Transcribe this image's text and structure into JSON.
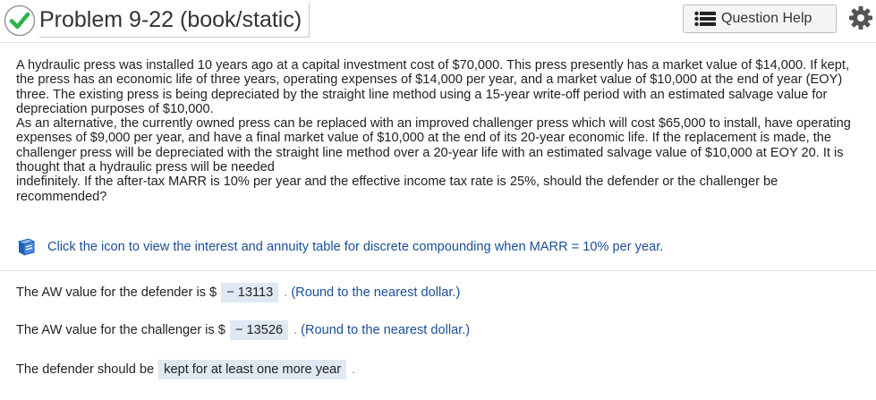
{
  "header": {
    "title": "Problem 9-22 (book/static)",
    "help_label": "Question Help",
    "status_icon": "check-circle-icon",
    "colors": {
      "check": "#2bb24c",
      "link": "#1a4f99",
      "answer_bg": "#dfe8f3"
    }
  },
  "problem": {
    "paragraph1": "A hydraulic press was installed 10 years ago at a capital investment cost of $70,000. This press presently has a market value of $14,000. If kept, the press has an economic life of three years, operating expenses of $14,000 per year, and a market value of $10,000 at the end of year (EOY) three. The existing press is being depreciated by the straight line method using a 15-year write-off period with an estimated salvage value for depreciation purposes of $10,000.",
    "paragraph2": "As an alternative, the currently owned press can be replaced with an improved challenger press which will cost $65,000 to install, have operating expenses of $9,000 per year, and have a final market value of $10,000 at the end of its 20-year economic life. If the replacement is made, the challenger press will be depreciated with the straight line method over a 20-year life with an estimated salvage value of $10,000 at EOY 20. It is thought that a hydraulic press will be needed",
    "paragraph3": "indefinitely. If the after-tax MARR is 10% per year and the effective income tax rate is 25%, should the defender or the challenger be recommended?"
  },
  "table_link": {
    "text": "Click the icon to view the interest and annuity table for discrete compounding when MARR = 10% per year."
  },
  "answers": {
    "defender": {
      "prefix": "The AW value for the defender is $",
      "value": "− 13113",
      "hint": "(Round to the nearest dollar.)"
    },
    "challenger": {
      "prefix": "The AW value for the challenger is $",
      "value": "− 13526",
      "hint": "(Round to the nearest dollar.)"
    },
    "recommendation": {
      "prefix": "The defender should be",
      "value": "kept for at least one more year"
    },
    "period": "."
  }
}
